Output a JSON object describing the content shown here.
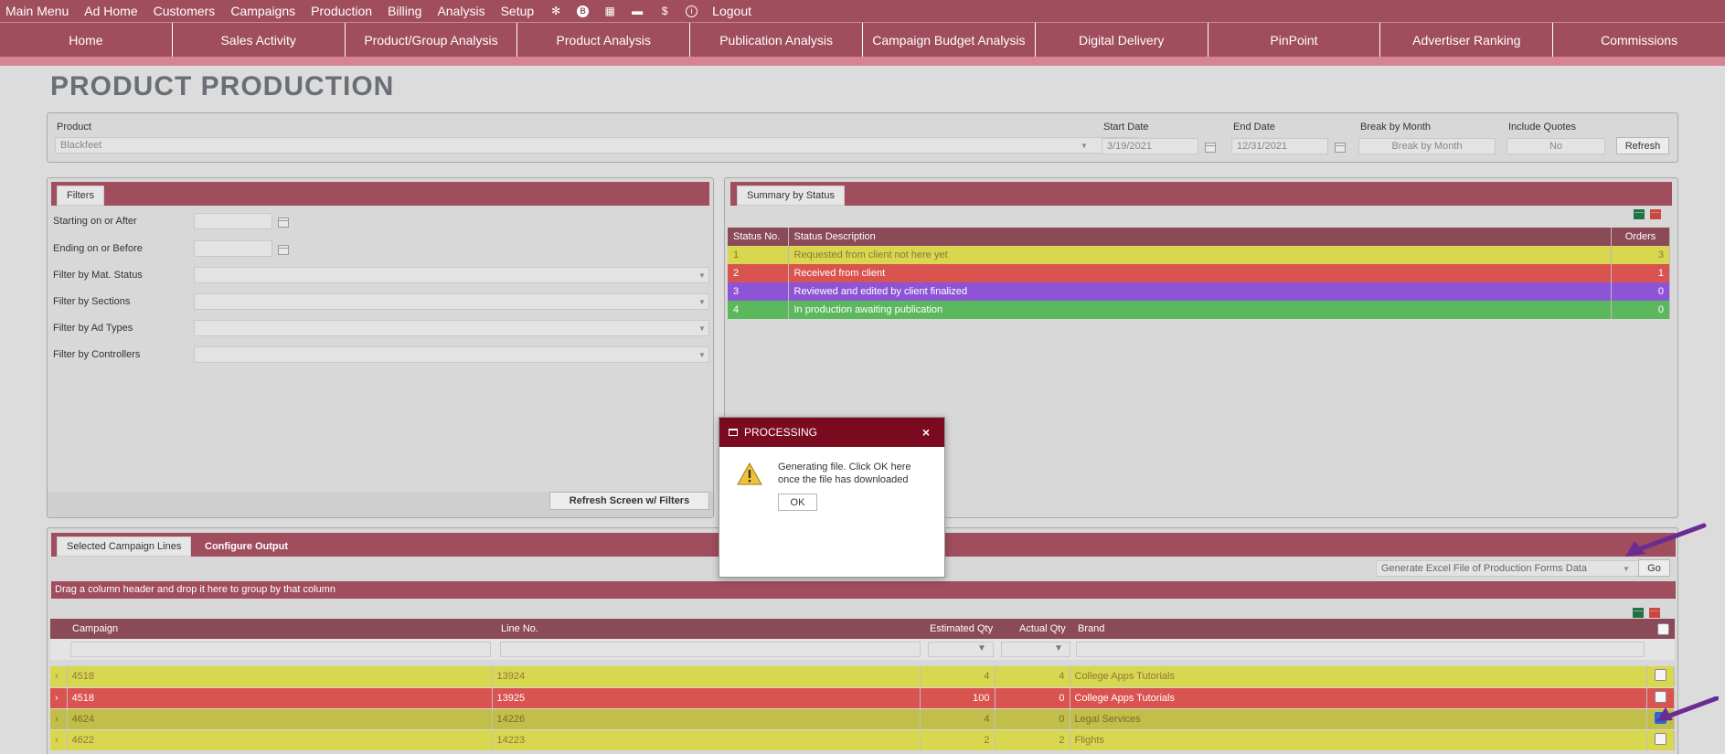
{
  "topmenu": {
    "items": [
      "Main Menu",
      "Ad Home",
      "Customers",
      "Campaigns",
      "Production",
      "Billing",
      "Analysis",
      "Setup"
    ],
    "logout": "Logout"
  },
  "subnav": [
    "Home",
    "Sales Activity",
    "Product/Group Analysis",
    "Product Analysis",
    "Publication Analysis",
    "Campaign Budget Analysis",
    "Digital Delivery",
    "PinPoint",
    "Advertiser Ranking",
    "Commissions"
  ],
  "page_title": "PRODUCT PRODUCTION",
  "criteria": {
    "product_label": "Product",
    "product_value": "Blackfeet",
    "start_label": "Start Date",
    "start_value": "3/19/2021",
    "end_label": "End Date",
    "end_value": "12/31/2021",
    "break_label": "Break by Month",
    "break_value": "Break by Month",
    "quotes_label": "Include Quotes",
    "quotes_value": "No",
    "refresh": "Refresh"
  },
  "filters": {
    "tab": "Filters",
    "starting": "Starting on or After",
    "ending": "Ending on or Before",
    "mat_status": "Filter by Mat. Status",
    "sections": "Filter by Sections",
    "ad_types": "Filter by Ad Types",
    "controllers": "Filter by Controllers",
    "refresh_btn": "Refresh Screen w/ Filters"
  },
  "summary": {
    "tab": "Summary by Status",
    "headers": [
      "Status No.",
      "Status Description",
      "Orders"
    ],
    "rows": [
      {
        "no": "1",
        "desc": "Requested from client not here yet",
        "orders": "3",
        "color": "#d9d64f",
        "text": "#8a7a3a"
      },
      {
        "no": "2",
        "desc": "Received from client",
        "orders": "1",
        "color": "#d9534f",
        "text": "#ffffff"
      },
      {
        "no": "3",
        "desc": "Reviewed and edited by client finalized",
        "orders": "0",
        "color": "#8e54d6",
        "text": "#ffffff"
      },
      {
        "no": "4",
        "desc": "In production awaiting publication",
        "orders": "0",
        "color": "#5cb85c",
        "text": "#ffffff"
      }
    ]
  },
  "modal": {
    "title": "PROCESSING",
    "message": "Generating file. Click OK here once the file has downloaded",
    "ok": "OK"
  },
  "campaign_lines": {
    "tab_selected": "Selected Campaign Lines",
    "tab_configure": "Configure Output",
    "output_select": "Generate Excel File of Production Forms Data",
    "go": "Go",
    "group_hint": "Drag a column header and drop it here to group by that column",
    "headers": [
      "Campaign",
      "Line No.",
      "Estimated Qty",
      "Actual Qty",
      "Brand"
    ],
    "rows": [
      {
        "campaign": "4518",
        "line": "13924",
        "est": "4",
        "act": "4",
        "brand": "College Apps Tutorials",
        "checked": false,
        "color": "#d9d64f",
        "text": "#8a7a3a"
      },
      {
        "campaign": "4518",
        "line": "13925",
        "est": "100",
        "act": "0",
        "brand": "College Apps Tutorials",
        "checked": false,
        "color": "#d9534f",
        "text": "#ffffff"
      },
      {
        "campaign": "4624",
        "line": "14226",
        "est": "4",
        "act": "0",
        "brand": "Legal Services",
        "checked": true,
        "color": "#c2be4a",
        "text": "#7a6a30"
      },
      {
        "campaign": "4622",
        "line": "14223",
        "est": "2",
        "act": "2",
        "brand": "Flights",
        "checked": false,
        "color": "#d9d64f",
        "text": "#8a7a3a"
      }
    ]
  },
  "colors": {
    "brand": "#a04d5e",
    "header": "#8b4a58",
    "modal": "#7a0a1e",
    "arrow": "#6a2c91"
  }
}
